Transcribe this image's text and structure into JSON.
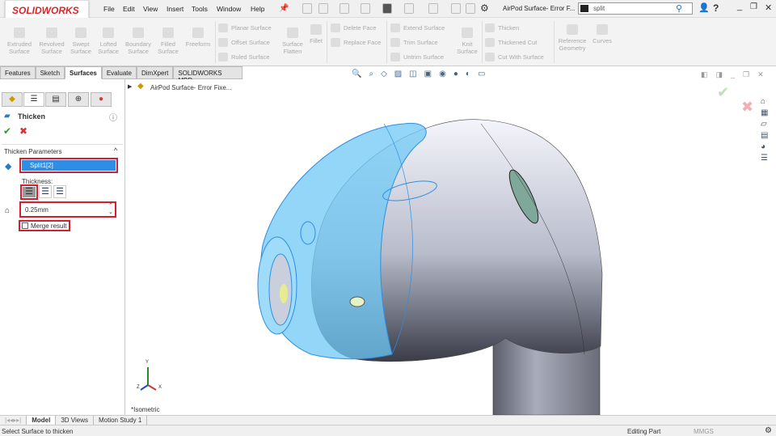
{
  "app": {
    "logo": "SOLIDWORKS",
    "document_title": "AirPod Surface- Error F...",
    "search_value": "split"
  },
  "menu": [
    "File",
    "Edit",
    "View",
    "Insert",
    "Tools",
    "Window",
    "Help"
  ],
  "ribbon": {
    "big": [
      "Extruded Surface",
      "Revolved Surface",
      "Swept Surface",
      "Lofted Surface",
      "Boundary Surface",
      "Filled Surface",
      "Freeform"
    ],
    "col1": [
      "Planar Surface",
      "Offset Surface",
      "Ruled Surface"
    ],
    "surface_flatten": "Surface Flatten",
    "fillet": "Fillet",
    "col2": [
      "Delete Face",
      "Replace Face"
    ],
    "col3": [
      "Extend Surface",
      "Trim Surface",
      "Untrim Surface"
    ],
    "knit": "Knit Surface",
    "col4": [
      "Thicken",
      "Thickened Cut",
      "Cut With Surface"
    ],
    "ref_geom": "Reference Geometry",
    "curves": "Curves"
  },
  "tabs": [
    {
      "label": "Features"
    },
    {
      "label": "Sketch"
    },
    {
      "label": "Surfaces",
      "active": true
    },
    {
      "label": "Evaluate"
    },
    {
      "label": "DimXpert"
    },
    {
      "label": "SOLIDWORKS MBD"
    }
  ],
  "panel": {
    "title": "Thicken",
    "section": "Thicken Parameters",
    "selection": "Split1[2]",
    "thickness_label": "Thickness:",
    "thickness_value": "0.25mm",
    "merge_label": "Merge result",
    "merge_checked": false
  },
  "viewport": {
    "tree_item": "AirPod Surface- Error Fixe...",
    "view_label": "*Isometric",
    "axes": [
      "Y",
      "Z",
      "X"
    ]
  },
  "bottom_tabs": [
    "Model",
    "3D Views",
    "Motion Study 1"
  ],
  "status": {
    "message": "Select Surface to thicken",
    "mode": "Editing Part",
    "units": "MMGS"
  },
  "colors": {
    "brand": "#d9262a",
    "highlight": "#d32030",
    "selection": "#2f8de4",
    "model_blue": "#6fc8f5"
  }
}
